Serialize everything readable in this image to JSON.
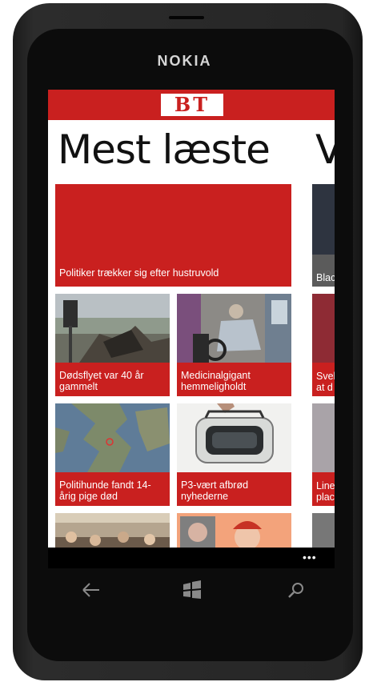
{
  "device": {
    "brand": "NOKIA"
  },
  "app": {
    "logo": "BT",
    "title": "Mest læste",
    "next_title": "V"
  },
  "tiles": [
    {
      "label": "Politiker trækker sig efter hustruvold"
    },
    {
      "label": "Dødsflyet var 40 år gammelt"
    },
    {
      "label": "Medicinalgigant hemmeligholdt"
    },
    {
      "label": "Politihunde fandt 14-årig pige død"
    },
    {
      "label": "P3-vært afbrød nyhederne"
    }
  ],
  "peek_tiles": [
    {
      "label": "Blac"
    },
    {
      "label": "Svel\nat d"
    },
    {
      "label": "Line\nplac"
    }
  ],
  "appbar": {
    "more": "•••"
  },
  "colors": {
    "accent": "#c9201f"
  },
  "icons": [
    "back-icon",
    "windows-start-icon",
    "search-icon"
  ]
}
